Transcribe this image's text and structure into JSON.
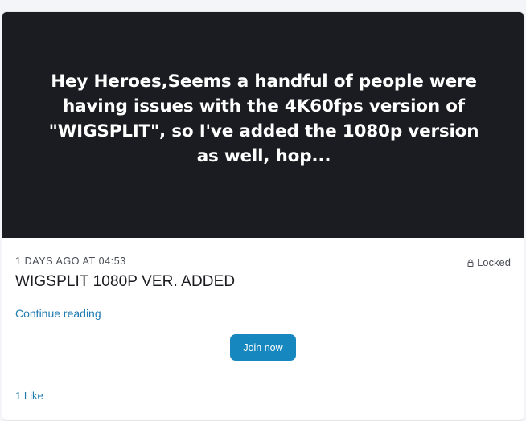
{
  "post": {
    "banner_text": "Hey Heroes,Seems a handful of people were having issues with the 4K60fps version of \"WIGSPLIT\", so I've added the 1080p version as well, hop...",
    "timestamp": "1 DAYS AGO AT 04:53",
    "lock_status": "Locked",
    "lock_icon": "lock-icon",
    "title": "WIGSPLIT 1080P VER. ADDED",
    "continue_label": "Continue reading",
    "join_label": "Join now",
    "likes_label": "1 Like"
  },
  "colors": {
    "banner_background": "#1b1c21",
    "accent_button": "#1787bf",
    "link": "#1f7ab0"
  }
}
